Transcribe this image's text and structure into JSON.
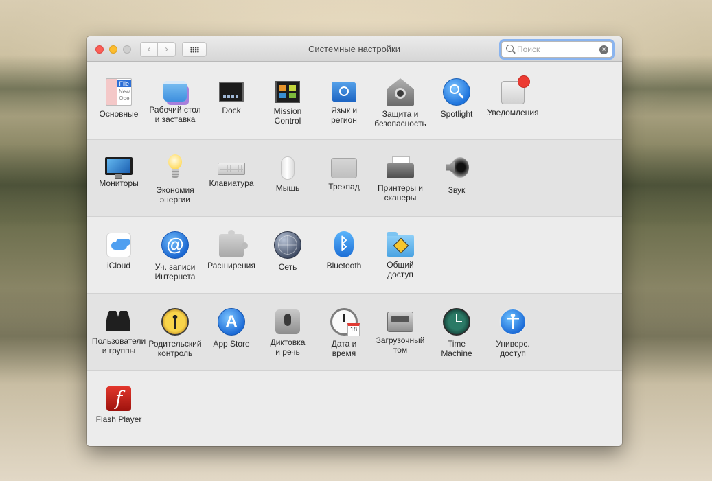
{
  "window": {
    "title": "Системные настройки"
  },
  "toolbar": {
    "back_glyph": "‹",
    "forward_glyph": "›",
    "search_placeholder": "Поиск",
    "search_value": "",
    "clear_glyph": "×"
  },
  "sections": [
    {
      "items": [
        {
          "label": "Основные",
          "icon": "general-icon"
        },
        {
          "label": "Рабочий стол\nи заставка",
          "icon": "desktop-screensaver-icon"
        },
        {
          "label": "Dock",
          "icon": "dock-icon"
        },
        {
          "label": "Mission\nControl",
          "icon": "mission-control-icon"
        },
        {
          "label": "Язык и\nрегион",
          "icon": "language-region-icon"
        },
        {
          "label": "Защита и\nбезопасность",
          "icon": "security-icon"
        },
        {
          "label": "Spotlight",
          "icon": "spotlight-icon"
        },
        {
          "label": "Уведомления",
          "icon": "notifications-icon"
        }
      ]
    },
    {
      "items": [
        {
          "label": "Мониторы",
          "icon": "displays-icon"
        },
        {
          "label": "Экономия\nэнергии",
          "icon": "energy-saver-icon"
        },
        {
          "label": "Клавиатура",
          "icon": "keyboard-icon"
        },
        {
          "label": "Мышь",
          "icon": "mouse-icon"
        },
        {
          "label": "Трекпад",
          "icon": "trackpad-icon"
        },
        {
          "label": "Принтеры и\nсканеры",
          "icon": "printer-icon"
        },
        {
          "label": "Звук",
          "icon": "sound-icon"
        }
      ]
    },
    {
      "items": [
        {
          "label": "iCloud",
          "icon": "icloud-icon"
        },
        {
          "label": "Уч. записи\nИнтернета",
          "icon": "internet-accounts-icon"
        },
        {
          "label": "Расширения",
          "icon": "extensions-icon"
        },
        {
          "label": "Сеть",
          "icon": "network-icon"
        },
        {
          "label": "Bluetooth",
          "icon": "bluetooth-icon"
        },
        {
          "label": "Общий\nдоступ",
          "icon": "sharing-icon"
        }
      ]
    },
    {
      "items": [
        {
          "label": "Пользователи\nи группы",
          "icon": "users-groups-icon"
        },
        {
          "label": "Родительский\nконтроль",
          "icon": "parental-controls-icon"
        },
        {
          "label": "App Store",
          "icon": "app-store-icon"
        },
        {
          "label": "Диктовка\nи речь",
          "icon": "dictation-icon"
        },
        {
          "label": "Дата и\nвремя",
          "icon": "date-time-icon"
        },
        {
          "label": "Загрузочный\nтом",
          "icon": "startup-disk-icon"
        },
        {
          "label": "Time\nMachine",
          "icon": "time-machine-icon"
        },
        {
          "label": "Универс.\nдоступ",
          "icon": "accessibility-icon"
        }
      ]
    },
    {
      "items": [
        {
          "label": "Flash Player",
          "icon": "flash-player-icon"
        }
      ]
    }
  ],
  "glyphs": {
    "internet": "@",
    "bluetooth": "ᛒ",
    "appstore": "A",
    "flash": "f"
  }
}
